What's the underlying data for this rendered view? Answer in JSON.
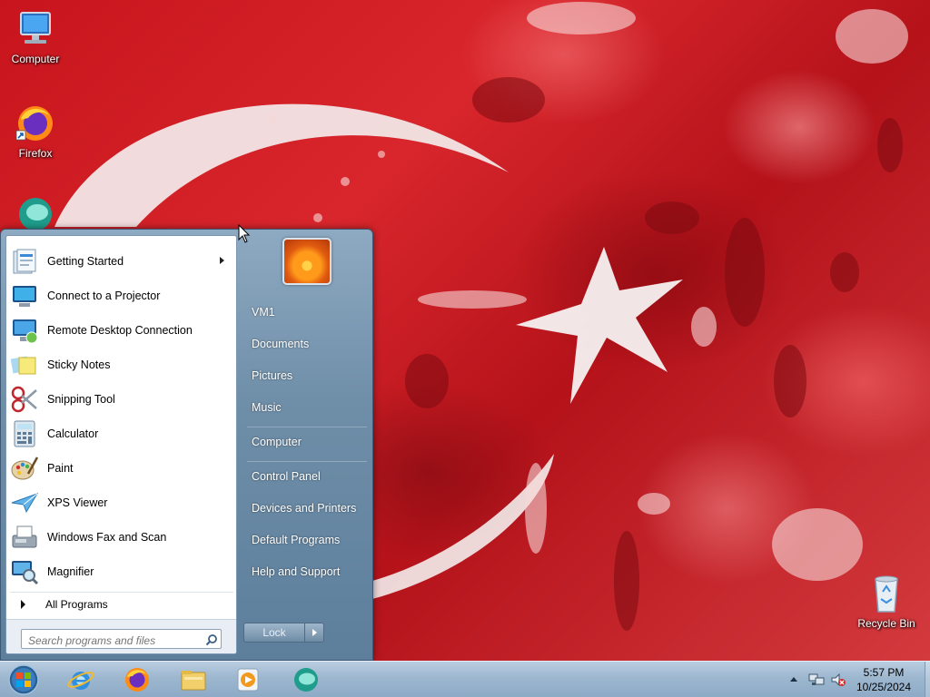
{
  "desktop": {
    "icons": [
      {
        "label": "Computer",
        "icon": "computer-icon"
      },
      {
        "label": "Firefox",
        "icon": "firefox-icon"
      },
      {
        "label": "",
        "icon": "chat-app-icon"
      },
      {
        "label": "Recycle Bin",
        "icon": "recycle-bin-icon"
      }
    ]
  },
  "start_menu": {
    "programs": [
      {
        "label": "Getting Started",
        "icon": "getting-started-icon",
        "has_submenu": true
      },
      {
        "label": "Connect to a Projector",
        "icon": "projector-icon"
      },
      {
        "label": "Remote Desktop Connection",
        "icon": "remote-desktop-icon"
      },
      {
        "label": "Sticky Notes",
        "icon": "sticky-notes-icon"
      },
      {
        "label": "Snipping Tool",
        "icon": "scissors-icon"
      },
      {
        "label": "Calculator",
        "icon": "calculator-icon"
      },
      {
        "label": "Paint",
        "icon": "paint-palette-icon"
      },
      {
        "label": "XPS Viewer",
        "icon": "xps-viewer-icon"
      },
      {
        "label": "Windows Fax and Scan",
        "icon": "fax-icon"
      },
      {
        "label": "Magnifier",
        "icon": "magnifier-icon"
      }
    ],
    "all_programs": "All Programs",
    "search_placeholder": "Search programs and files",
    "right_links": [
      {
        "label": "VM1"
      },
      {
        "label": "Documents"
      },
      {
        "label": "Pictures"
      },
      {
        "label": "Music"
      },
      {
        "label": "Computer"
      },
      {
        "label": "Control Panel"
      },
      {
        "label": "Devices and Printers"
      },
      {
        "label": "Default Programs"
      },
      {
        "label": "Help and Support"
      }
    ],
    "lock_label": "Lock"
  },
  "taskbar": {
    "pinned": [
      "internet-explorer-icon",
      "firefox-icon",
      "file-explorer-icon",
      "media-player-icon",
      "chat-app-icon"
    ],
    "tray_icons": [
      "show-hidden-icons-icon",
      "network-icon",
      "volume-muted-icon"
    ],
    "time": "5:57 PM",
    "date": "10/25/2024"
  },
  "colors": {
    "wallpaper_red": "#c8151d",
    "taskbar": "#9db7cf",
    "start_menu_frame": "#6f8ea8"
  }
}
